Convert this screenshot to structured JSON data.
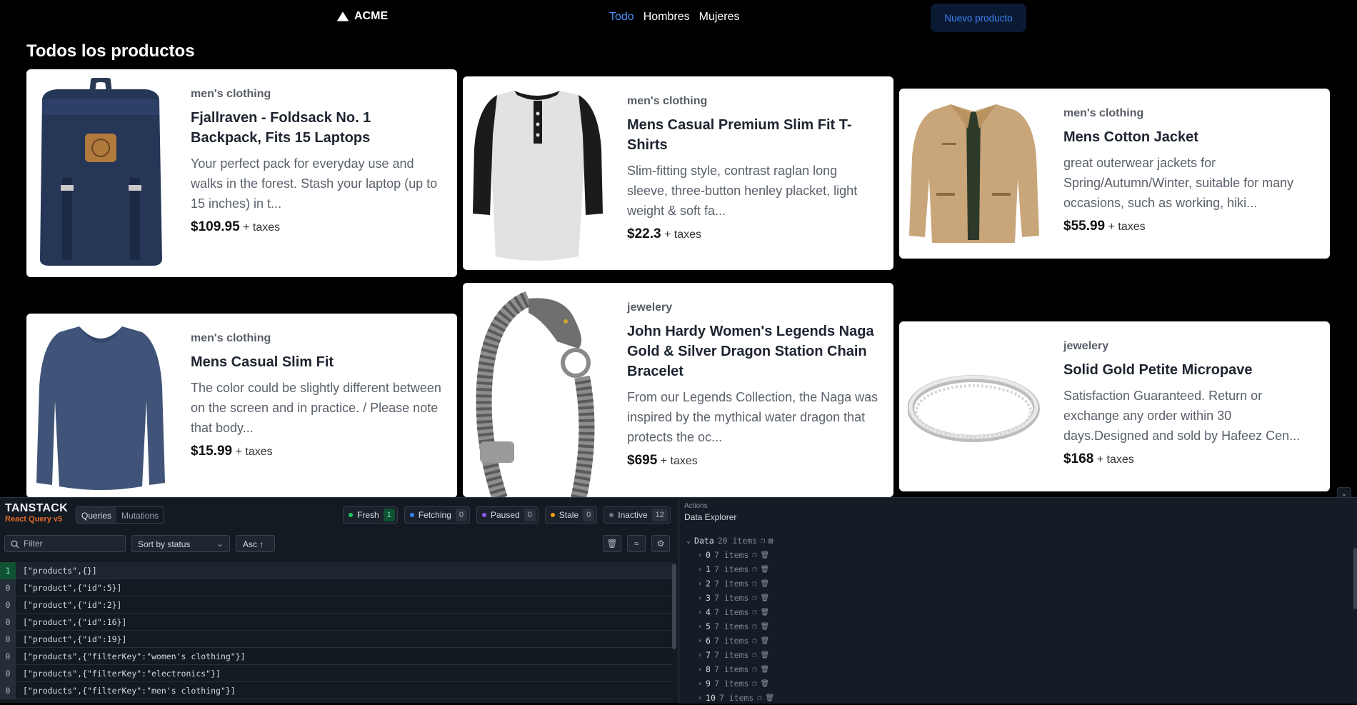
{
  "nav": {
    "brand": "ACME",
    "links": [
      "Todo",
      "Hombres",
      "Mujeres"
    ],
    "active": "Todo",
    "new_button": "Nuevo producto"
  },
  "page": {
    "title": "Todos los productos"
  },
  "products": [
    {
      "category": "men's clothing",
      "title": "Fjallraven - Foldsack No. 1 Backpack, Fits 15 Laptops",
      "description": "Your perfect pack for everyday use and walks in the forest. Stash your laptop (up to 15 inches) in t...",
      "price": "$109.95",
      "taxes": "+ taxes",
      "image": "backpack"
    },
    {
      "category": "men's clothing",
      "title": "Mens Casual Premium Slim Fit T-Shirts",
      "description": "Slim-fitting style, contrast raglan long sleeve, three-button henley placket, light weight & soft fa...",
      "price": "$22.3",
      "taxes": "+ taxes",
      "image": "tshirt"
    },
    {
      "category": "men's clothing",
      "title": "Mens Cotton Jacket",
      "description": "great outerwear jackets for Spring/Autumn/Winter, suitable for many occasions, such as working, hiki...",
      "price": "$55.99",
      "taxes": "+ taxes",
      "image": "jacket"
    },
    {
      "category": "men's clothing",
      "title": "Mens Casual Slim Fit",
      "description": "The color could be slightly different between on the screen and in practice. / Please note that body...",
      "price": "$15.99",
      "taxes": "+ taxes",
      "image": "longsleeve"
    },
    {
      "category": "jewelery",
      "title": "John Hardy Women's Legends Naga Gold & Silver Dragon Station Chain Bracelet",
      "description": "From our Legends Collection, the Naga was inspired by the mythical water dragon that protects the oc...",
      "price": "$695",
      "taxes": "+ taxes",
      "image": "bracelet"
    },
    {
      "category": "jewelery",
      "title": "Solid Gold Petite Micropave",
      "description": "Satisfaction Guaranteed. Return or exchange any order within 30 days.Designed and sold by Hafeez Cen...",
      "price": "$168",
      "taxes": "+ taxes",
      "image": "ring"
    }
  ],
  "devtools": {
    "logo_top": "TANSTACK",
    "logo_bottom": "React Query v5",
    "tabs": [
      "Queries",
      "Mutations"
    ],
    "active_tab": "Queries",
    "statuses": [
      {
        "label": "Fresh",
        "count": "1",
        "color": "#22c55e"
      },
      {
        "label": "Fetching",
        "count": "0",
        "color": "#3b82f6"
      },
      {
        "label": "Paused",
        "count": "0",
        "color": "#8b5cf6"
      },
      {
        "label": "Stale",
        "count": "0",
        "color": "#f59e0b"
      },
      {
        "label": "Inactive",
        "count": "12",
        "color": "#6b7280"
      }
    ],
    "filter_placeholder": "Filter",
    "sort_label": "Sort by status",
    "order_label": "Asc",
    "queries": [
      {
        "count": "1",
        "key": "[\"products\",{}]",
        "fresh": true
      },
      {
        "count": "0",
        "key": "[\"product\",{\"id\":5}]"
      },
      {
        "count": "0",
        "key": "[\"product\",{\"id\":2}]"
      },
      {
        "count": "0",
        "key": "[\"product\",{\"id\":16}]"
      },
      {
        "count": "0",
        "key": "[\"product\",{\"id\":19}]"
      },
      {
        "count": "0",
        "key": "[\"products\",{\"filterKey\":\"women's clothing\"}]"
      },
      {
        "count": "0",
        "key": "[\"products\",{\"filterKey\":\"electronics\"}]"
      },
      {
        "count": "0",
        "key": "[\"products\",{\"filterKey\":\"men's clothing\"}]"
      }
    ],
    "actions_label": "Actions",
    "explorer_label": "Data Explorer",
    "root_key": "Data",
    "root_count": "20 items",
    "tree_items": [
      {
        "key": "0",
        "count": "7 items"
      },
      {
        "key": "1",
        "count": "7 items"
      },
      {
        "key": "2",
        "count": "7 items"
      },
      {
        "key": "3",
        "count": "7 items"
      },
      {
        "key": "4",
        "count": "7 items"
      },
      {
        "key": "5",
        "count": "7 items"
      },
      {
        "key": "6",
        "count": "7 items"
      },
      {
        "key": "7",
        "count": "7 items"
      },
      {
        "key": "8",
        "count": "7 items"
      },
      {
        "key": "9",
        "count": "7 items"
      },
      {
        "key": "10",
        "count": "7 items"
      }
    ]
  }
}
